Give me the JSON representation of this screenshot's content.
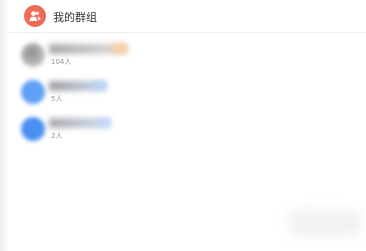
{
  "header": {
    "icon": "group-icon",
    "title": "我的群组",
    "icon_color": "#ef6a57"
  },
  "groups": [
    {
      "member_count": "104人"
    },
    {
      "member_count": "5人"
    },
    {
      "member_count": "2人"
    }
  ]
}
